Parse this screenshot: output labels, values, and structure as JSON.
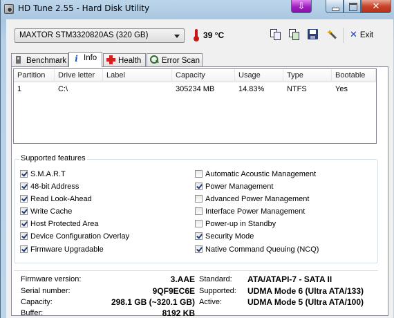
{
  "window": {
    "title": "HD Tune 2.55 - Hard Disk Utility",
    "special_button_glyph": "⇩",
    "close_glyph": "✕"
  },
  "toolbar": {
    "drive": "MAXTOR STM3320820AS (320 GB)",
    "temperature": "39 °C",
    "exit_label": "Exit",
    "icons": [
      "copy-icon",
      "copy-screenshot-icon",
      "save-icon",
      "options-icon",
      "exit-icon"
    ]
  },
  "tabs": [
    {
      "label": "Benchmark",
      "icon": "benchmark-icon",
      "active": false
    },
    {
      "label": "Info",
      "icon": "info-icon",
      "active": true
    },
    {
      "label": "Health",
      "icon": "health-icon",
      "active": false
    },
    {
      "label": "Error Scan",
      "icon": "magnifier-icon",
      "active": false
    }
  ],
  "partitions": {
    "columns": [
      "Partition",
      "Drive letter",
      "Label",
      "Capacity",
      "Usage",
      "Type",
      "Bootable"
    ],
    "rows": [
      [
        "1",
        "C:\\",
        "",
        "305234 MB",
        "14.83%",
        "NTFS",
        "Yes"
      ]
    ]
  },
  "features": {
    "title": "Supported features",
    "left": [
      {
        "label": "S.M.A.R.T",
        "checked": true
      },
      {
        "label": "48-bit Address",
        "checked": true
      },
      {
        "label": "Read Look-Ahead",
        "checked": true
      },
      {
        "label": "Write Cache",
        "checked": true
      },
      {
        "label": "Host Protected Area",
        "checked": true
      },
      {
        "label": "Device Configuration Overlay",
        "checked": true
      },
      {
        "label": "Firmware Upgradable",
        "checked": true
      }
    ],
    "right": [
      {
        "label": "Automatic Acoustic Management",
        "checked": false
      },
      {
        "label": "Power Management",
        "checked": true
      },
      {
        "label": "Advanced Power Management",
        "checked": false
      },
      {
        "label": "Interface Power Management",
        "checked": false
      },
      {
        "label": "Power-up in Standby",
        "checked": false
      },
      {
        "label": "Security Mode",
        "checked": true
      },
      {
        "label": "Native Command Queuing (NCQ)",
        "checked": true
      }
    ]
  },
  "details": {
    "firmware_label": "Firmware version:",
    "firmware_value": "3.AAE",
    "serial_label": "Serial number:",
    "serial_value": "9QF9EC6E",
    "capacity_label": "Capacity:",
    "capacity_value": "298.1 GB (~320.1 GB)",
    "buffer_label": "Buffer:",
    "buffer_value": "8192 KB",
    "standard_label": "Standard:",
    "standard_value": "ATA/ATAPI-7 - SATA II",
    "supported_label": "Supported:",
    "supported_value": "UDMA Mode 6 (Ultra ATA/133)",
    "active_label": "Active:",
    "active_value": "UDMA Mode 5 (Ultra ATA/100)"
  }
}
